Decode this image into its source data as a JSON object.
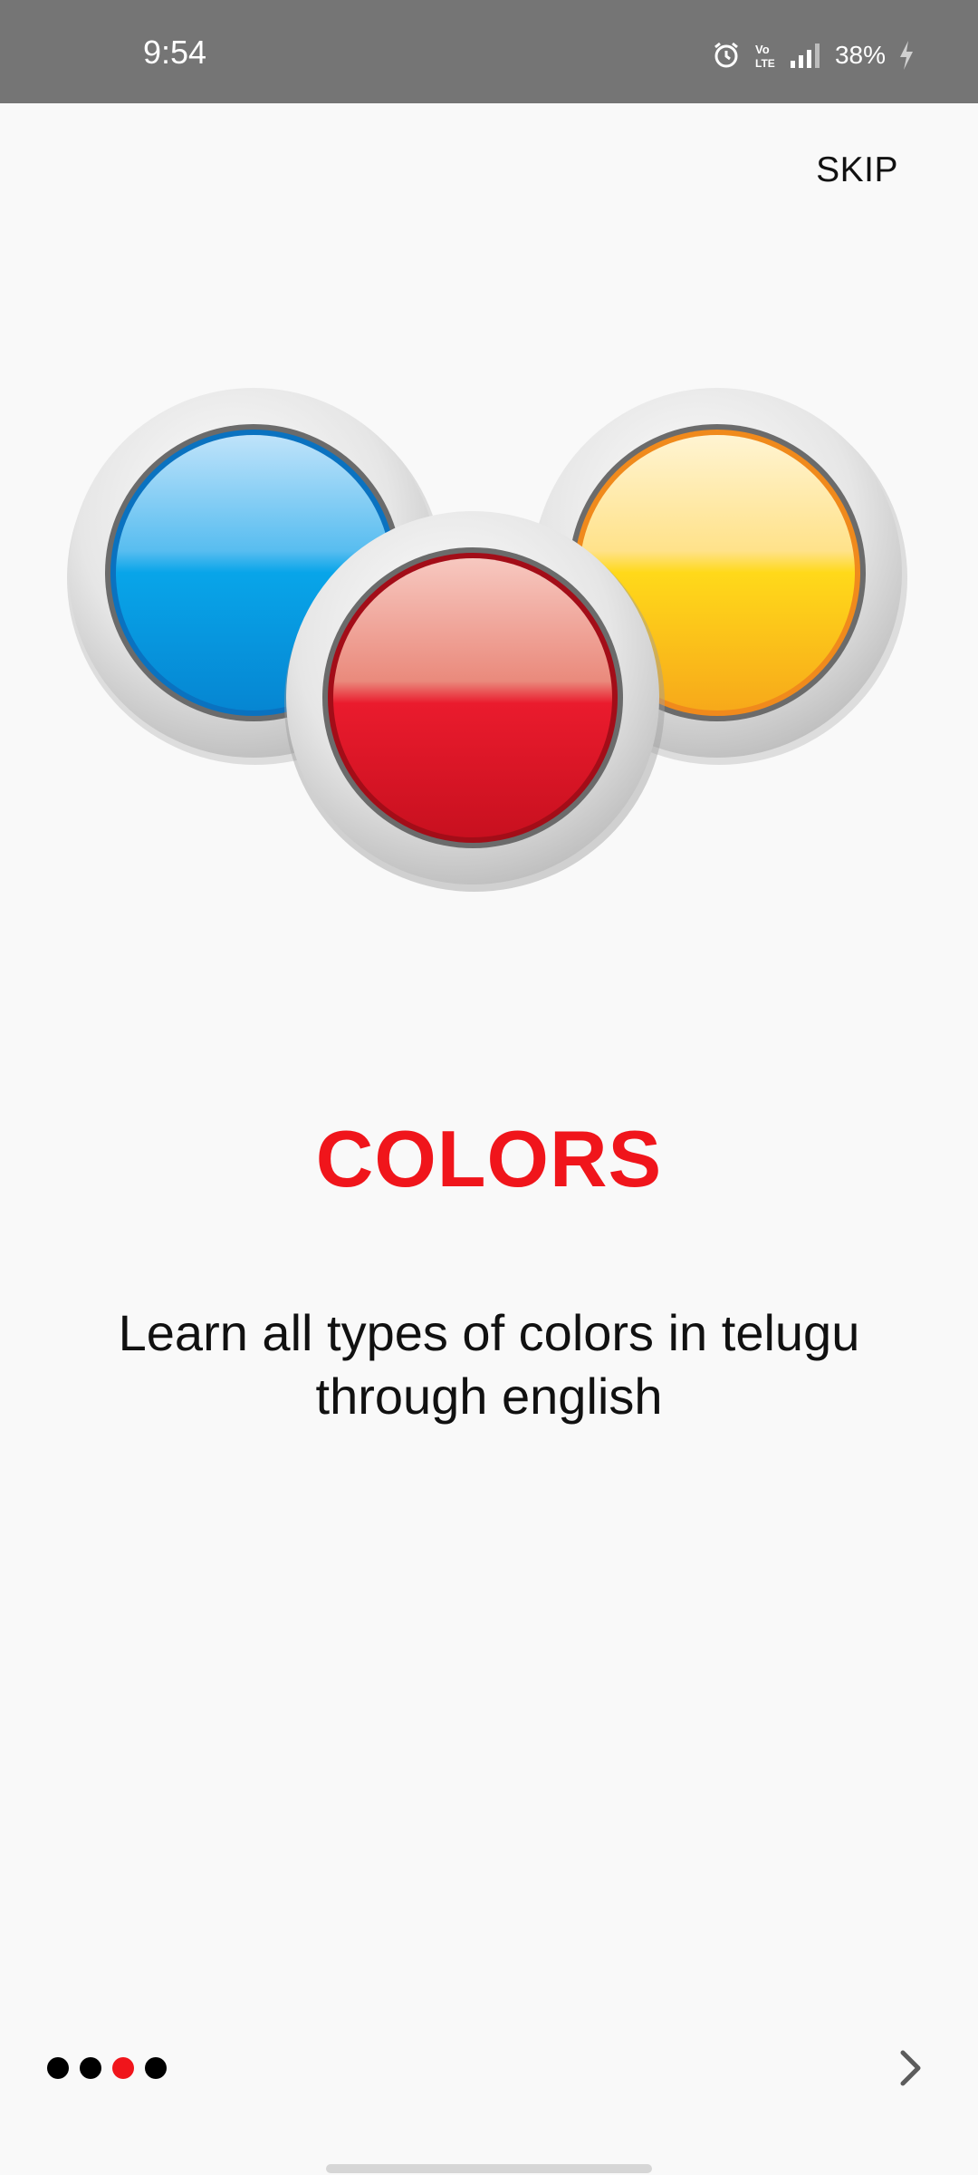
{
  "status_bar": {
    "time": "9:54",
    "battery": "38%",
    "icons": [
      "alarm-icon",
      "volte-icon",
      "signal-icon",
      "battery-charging-icon"
    ]
  },
  "skip_label": "SKIP",
  "illustration": {
    "icon": "color-buttons-illustration",
    "colors": [
      "#1aa6ea",
      "#ee1c2c",
      "#ffd21a"
    ]
  },
  "title": "COLORS",
  "subtitle": "Learn all types of colors in telugu through english",
  "pager": {
    "total": 4,
    "active_index": 2,
    "active_color": "#f0151b"
  },
  "next_icon": "chevron-right-icon"
}
